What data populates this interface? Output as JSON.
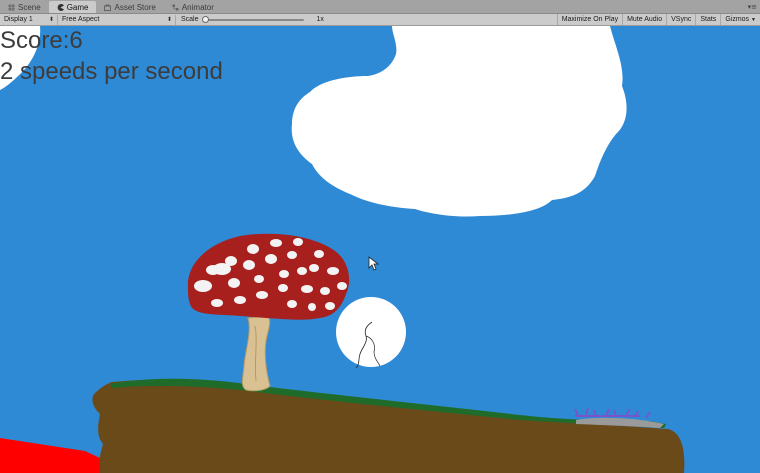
{
  "tabs": [
    {
      "label": "Scene",
      "icon": "hash-icon",
      "active": false
    },
    {
      "label": "Game",
      "icon": "pacman-icon",
      "active": true
    },
    {
      "label": "Asset Store",
      "icon": "store-icon",
      "active": false
    },
    {
      "label": "Animator",
      "icon": "animator-icon",
      "active": false
    }
  ],
  "toolbar": {
    "display": "Display 1",
    "aspect": "Free Aspect",
    "scale_label": "Scale",
    "scale_value": "1x",
    "scale_level": 0.0,
    "maximize_on_play": "Maximize On Play",
    "mute_audio": "Mute Audio",
    "vsync": "VSync",
    "stats": "Stats",
    "gizmos": "Gizmos"
  },
  "hud": {
    "score": "Score:6",
    "speed": "2 speeds per second"
  },
  "colors": {
    "sky": "#2f8ad6",
    "cloud": "#ffffff",
    "ground": "#6b4a1a",
    "grass": "#1f6b2a",
    "mushroom_cap": "#a8201d",
    "mushroom_stem": "#d9c193",
    "hazard": "#ff0000"
  }
}
